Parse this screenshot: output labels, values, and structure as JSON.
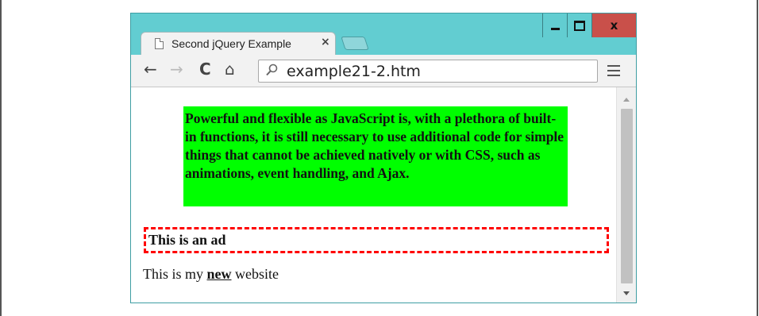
{
  "window": {
    "controls": {
      "minimize": "minimize",
      "maximize": "maximize",
      "close": "x"
    }
  },
  "tab": {
    "title": "Second jQuery Example",
    "close_label": "×"
  },
  "toolbar": {
    "back_icon": "←",
    "forward_icon": "→",
    "reload_icon": "C",
    "home_icon": "⌂",
    "url": "example21-2.htm"
  },
  "page": {
    "green_paragraph": "Powerful and flexible as JavaScript is, with a plethora of built-in functions, it is still necessary to use additional code for simple things that cannot be achieved natively or with CSS, such as animations, event handling, and Ajax.",
    "ad_text": "This is an ad",
    "line_prefix": "This is my",
    "line_bold": "new",
    "line_suffix": "website"
  },
  "colors": {
    "frame": "#62cdd1",
    "close_button": "#c9504a",
    "green_background": "#00ff00",
    "ad_border": "#ff0000"
  }
}
